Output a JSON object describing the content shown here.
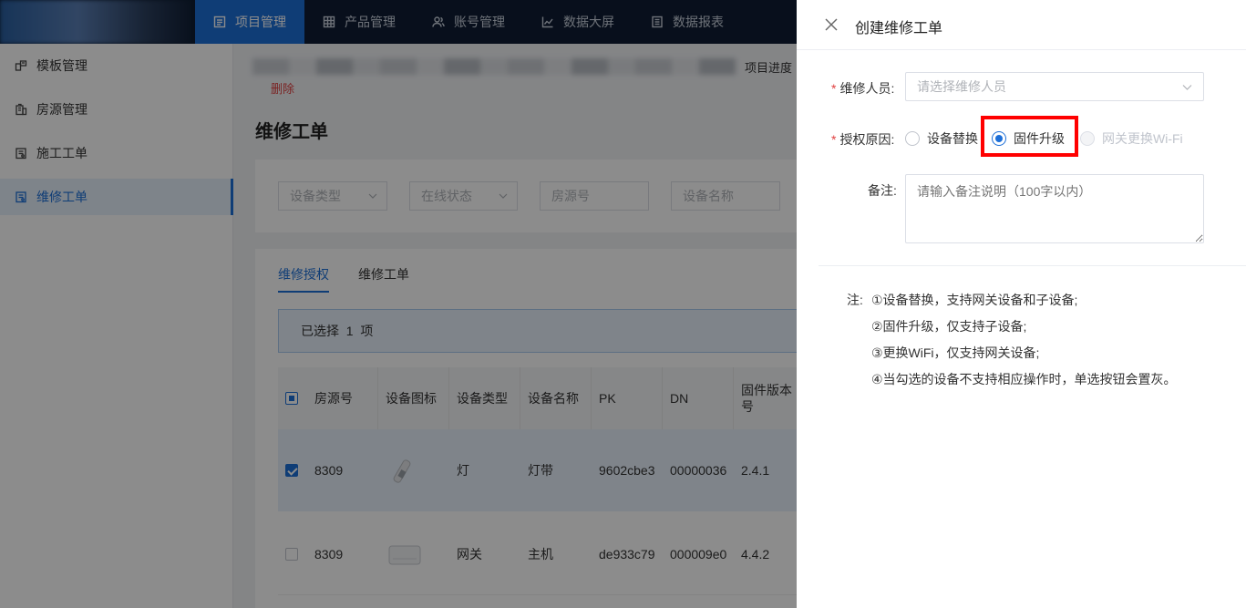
{
  "topbar": {
    "nav": [
      {
        "label": "项目管理",
        "icon": "list-icon",
        "active": true
      },
      {
        "label": "产品管理",
        "icon": "grid-icon",
        "active": false
      },
      {
        "label": "账号管理",
        "icon": "users-icon",
        "active": false
      },
      {
        "label": "数据大屏",
        "icon": "chart-icon",
        "active": false
      },
      {
        "label": "数据报表",
        "icon": "report-icon",
        "active": false
      }
    ]
  },
  "sidebar": {
    "items": [
      {
        "label": "模板管理",
        "icon": "template-icon",
        "active": false
      },
      {
        "label": "房源管理",
        "icon": "building-icon",
        "active": false
      },
      {
        "label": "施工工单",
        "icon": "clipboard-icon",
        "active": false
      },
      {
        "label": "维修工单",
        "icon": "clipboard-icon",
        "active": true
      }
    ]
  },
  "main": {
    "progress_label": "项目进度",
    "delete_label": "删除",
    "title": "维修工单",
    "filters": [
      {
        "placeholder": "设备类型",
        "dropdown": true
      },
      {
        "placeholder": "在线状态",
        "dropdown": true
      },
      {
        "placeholder": "房源号",
        "dropdown": false
      },
      {
        "placeholder": "设备名称",
        "dropdown": false
      }
    ],
    "tabs": [
      {
        "label": "维修授权",
        "active": true
      },
      {
        "label": "维修工单",
        "active": false
      }
    ],
    "selected_text": "已选择  1  项",
    "table": {
      "columns": [
        "房源号",
        "设备图标",
        "设备类型",
        "设备名称",
        "PK",
        "DN",
        "固件版本号"
      ],
      "rows": [
        {
          "room": "8309",
          "type": "灯",
          "name": "灯带",
          "pk": "9602cbe3",
          "dn": "00000036",
          "fw": "2.4.1",
          "checked": true
        },
        {
          "room": "8309",
          "type": "网关",
          "name": "主机",
          "pk": "de933c79",
          "dn": "000009e0",
          "fw": "4.4.2",
          "checked": false
        }
      ]
    }
  },
  "drawer": {
    "title": "创建维修工单",
    "repair_person_label": "维修人员:",
    "repair_person_placeholder": "请选择维修人员",
    "reason_label": "授权原因:",
    "reasons": [
      {
        "label": "设备替换",
        "state": "unchecked"
      },
      {
        "label": "固件升级",
        "state": "checked"
      },
      {
        "label": "网关更换Wi-Fi",
        "state": "disabled"
      }
    ],
    "remark_label": "备注:",
    "remark_placeholder": "请输入备注说明（100字以内）",
    "notes_prefix": "注:",
    "notes": [
      "①设备替换，支持网关设备和子设备;",
      "②固件升级，仅支持子设备;",
      "③更换WiFi，仅支持网关设备;",
      "④当勾选的设备不支持相应操作时，单选按钮会置灰。"
    ]
  },
  "colors": {
    "accent": "#1d6fd8",
    "topbar": "#0f1d33",
    "required": "#e04040",
    "highlight": "#ff0000"
  }
}
